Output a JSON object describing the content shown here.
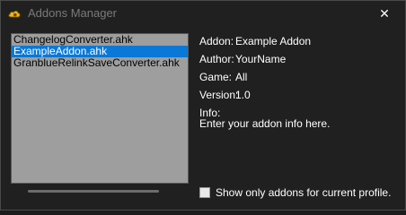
{
  "window": {
    "title": "Addons Manager",
    "close_glyph": "✕",
    "app_icon": "cloud-icon"
  },
  "addons": {
    "items": [
      {
        "label": "ChangelogConverter.ahk",
        "selected": false
      },
      {
        "label": "ExampleAddon.ahk",
        "selected": true
      },
      {
        "label": "GranblueRelinkSaveConverter.ahk",
        "selected": false
      }
    ]
  },
  "details": {
    "addon_label": "Addon:",
    "addon_value": "Example Addon",
    "author_label": "Author:",
    "author_value": "YourName",
    "game_label": "Game:",
    "game_value": "All",
    "version_label": "Version:",
    "version_value": "1.0",
    "info_label": "Info:",
    "info_value": "Enter your addon info here."
  },
  "filter": {
    "checkbox_label": "Show only addons for current profile.",
    "checked": false
  },
  "colors": {
    "selection": "#0a78d7",
    "list_bg": "#9e9e9e",
    "window_bg": "#202020"
  }
}
